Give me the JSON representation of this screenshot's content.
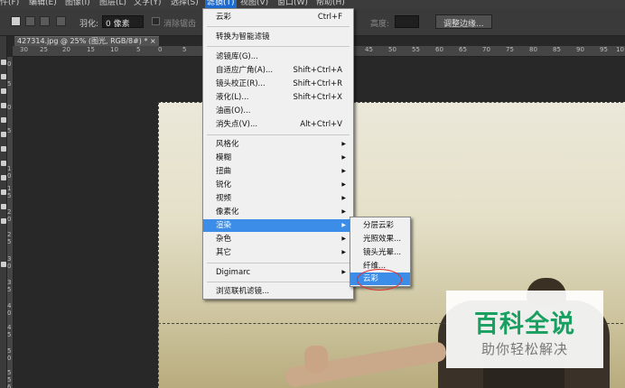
{
  "menubar": {
    "items": [
      "件(F)",
      "编辑(E)",
      "图像(I)",
      "图层(L)",
      "文字(Y)",
      "选择(S)",
      "滤镜(T)",
      "视图(V)",
      "窗口(W)",
      "帮助(H)"
    ],
    "active_index": 6
  },
  "options": {
    "feather_label": "羽化:",
    "feather_value": "0 像素",
    "antialias_label": "消除锯齿",
    "height_label": "高度:",
    "refine_edge_label": "调整边缘..."
  },
  "document": {
    "tab_title": "427314.jpg @ 25% (图光, RGB/8#) * ×"
  },
  "rulers": {
    "h_labels": [
      "30",
      "25",
      "20",
      "15",
      "10",
      "5",
      "0",
      "5",
      "45",
      "50",
      "55",
      "60",
      "65",
      "70",
      "75",
      "80",
      "85",
      "90",
      "95",
      "10"
    ],
    "v_labels": [
      "0",
      "5",
      "0",
      "5",
      "1",
      "0",
      "1",
      "5",
      "2",
      "0",
      "2",
      "5",
      "3",
      "0",
      "3",
      "5",
      "4",
      "0",
      "4",
      "5",
      "5",
      "0",
      "5",
      "5",
      "6"
    ]
  },
  "filter_menu": {
    "items": [
      {
        "label": "云彩",
        "shortcut": "Ctrl+F"
      },
      {
        "label": "转换为智能滤镜"
      },
      {
        "label": "滤镜库(G)..."
      },
      {
        "label": "自适应广角(A)...",
        "shortcut": "Shift+Ctrl+A"
      },
      {
        "label": "镜头校正(R)...",
        "shortcut": "Shift+Ctrl+R"
      },
      {
        "label": "液化(L)...",
        "shortcut": "Shift+Ctrl+X"
      },
      {
        "label": "油画(O)..."
      },
      {
        "label": "消失点(V)...",
        "shortcut": "Alt+Ctrl+V"
      },
      {
        "label": "风格化",
        "arrow": "▶"
      },
      {
        "label": "模糊",
        "arrow": "▶"
      },
      {
        "label": "扭曲",
        "arrow": "▶"
      },
      {
        "label": "锐化",
        "arrow": "▶"
      },
      {
        "label": "视频",
        "arrow": "▶"
      },
      {
        "label": "像素化",
        "arrow": "▶"
      },
      {
        "label": "渲染",
        "arrow": "▶"
      },
      {
        "label": "杂色",
        "arrow": "▶"
      },
      {
        "label": "其它",
        "arrow": "▶"
      },
      {
        "label": "Digimarc",
        "arrow": "▶"
      },
      {
        "label": "浏览联机滤镜..."
      }
    ],
    "highlighted_index": 14
  },
  "render_submenu": {
    "items": [
      "分层云彩",
      "光照效果...",
      "镜头光晕...",
      "纤维...",
      "云彩"
    ],
    "highlighted_index": 4
  },
  "watermark": {
    "main": "百科全说",
    "sub": "助你轻松解决"
  },
  "colors": {
    "menu_highlight": "#3c8de8",
    "watermark_green": "#19a060",
    "annotation_red": "#e0302a"
  }
}
